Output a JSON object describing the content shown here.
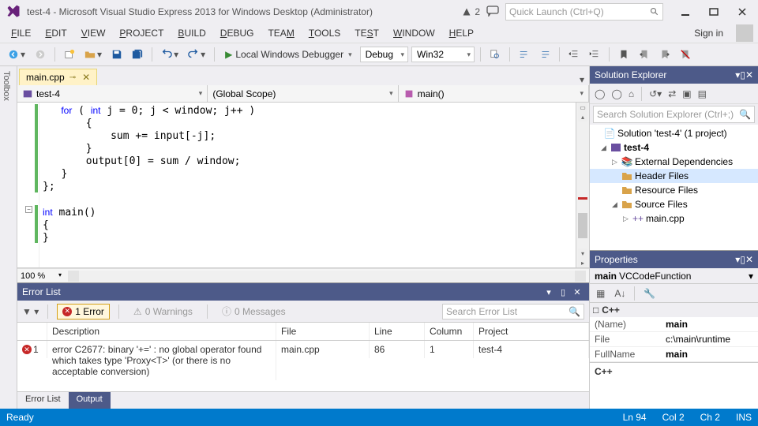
{
  "title": "test-4 - Microsoft Visual Studio Express 2013 for Windows Desktop (Administrator)",
  "notif_count": "2",
  "quicklaunch_placeholder": "Quick Launch (Ctrl+Q)",
  "menu": {
    "file": "FILE",
    "edit": "EDIT",
    "view": "VIEW",
    "project": "PROJECT",
    "build": "BUILD",
    "debug": "DEBUG",
    "team": "TEAM",
    "tools": "TOOLS",
    "test": "TEST",
    "window": "WINDOW",
    "help": "HELP",
    "signin": "Sign in"
  },
  "toolbar": {
    "start": "Local Windows Debugger",
    "config": "Debug",
    "platform": "Win32"
  },
  "toolbox_label": "Toolbox",
  "doc_tab": {
    "name": "main.cpp"
  },
  "nav": {
    "left": "test-4",
    "mid": "(Global Scope)",
    "right": "main()"
  },
  "code_lines": [
    "       for ( int j = 0; j < window; j++ )",
    "       {",
    "           sum += input[-j];",
    "       }",
    "       output[0] = sum / window;",
    "   }",
    "};",
    "",
    "int main()",
    "{",
    "}"
  ],
  "zoom": "100 %",
  "errorlist": {
    "title": "Error List",
    "errors_label": "1 Error",
    "warnings_label": "0 Warnings",
    "messages_label": "0 Messages",
    "search_placeholder": "Search Error List",
    "cols": {
      "desc": "Description",
      "file": "File",
      "line": "Line",
      "col": "Column",
      "project": "Project"
    },
    "rows": [
      {
        "n": "1",
        "desc": "error C2677: binary '+=' : no global operator found which takes type 'Proxy<T>' (or there is no acceptable conversion)",
        "file": "main.cpp",
        "line": "86",
        "col": "1",
        "project": "test-4"
      }
    ],
    "tabs": {
      "errorlist": "Error List",
      "output": "Output"
    }
  },
  "solution": {
    "title": "Solution Explorer",
    "search_placeholder": "Search Solution Explorer (Ctrl+;)",
    "root": "Solution 'test-4' (1 project)",
    "project": "test-4",
    "ext": "External Dependencies",
    "hdr": "Header Files",
    "res": "Resource Files",
    "src": "Source Files",
    "main": "main.cpp"
  },
  "properties": {
    "title": "Properties",
    "obj": "main",
    "objtype": "VCCodeFunction",
    "cat": "C++",
    "rows": [
      {
        "n": "(Name)",
        "v": "main"
      },
      {
        "n": "File",
        "v": "c:\\main\\runtime"
      },
      {
        "n": "FullName",
        "v": "main"
      }
    ],
    "desc": "C++"
  },
  "status": {
    "ready": "Ready",
    "ln": "Ln 94",
    "col": "Col 2",
    "ch": "Ch 2",
    "ins": "INS"
  }
}
